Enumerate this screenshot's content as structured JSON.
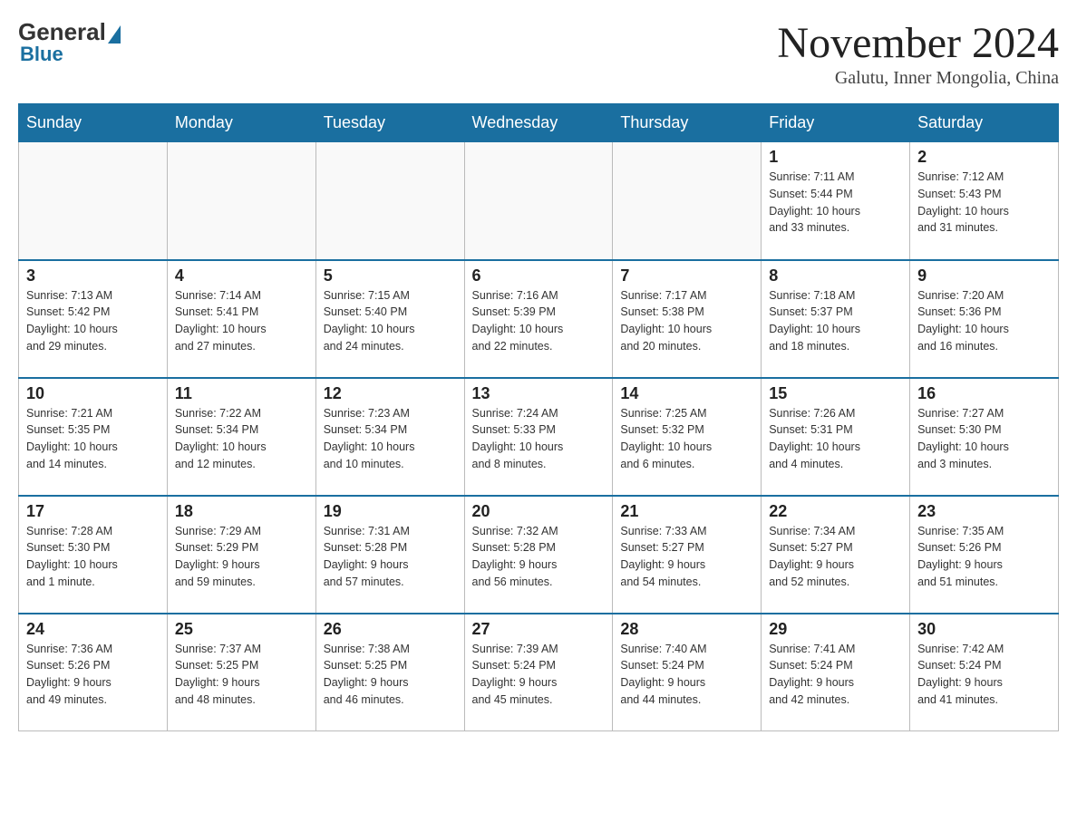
{
  "header": {
    "logo": {
      "general": "General",
      "blue": "Blue"
    },
    "title": "November 2024",
    "location": "Galutu, Inner Mongolia, China"
  },
  "days_of_week": [
    "Sunday",
    "Monday",
    "Tuesday",
    "Wednesday",
    "Thursday",
    "Friday",
    "Saturday"
  ],
  "weeks": [
    [
      {
        "day": "",
        "info": ""
      },
      {
        "day": "",
        "info": ""
      },
      {
        "day": "",
        "info": ""
      },
      {
        "day": "",
        "info": ""
      },
      {
        "day": "",
        "info": ""
      },
      {
        "day": "1",
        "info": "Sunrise: 7:11 AM\nSunset: 5:44 PM\nDaylight: 10 hours\nand 33 minutes."
      },
      {
        "day": "2",
        "info": "Sunrise: 7:12 AM\nSunset: 5:43 PM\nDaylight: 10 hours\nand 31 minutes."
      }
    ],
    [
      {
        "day": "3",
        "info": "Sunrise: 7:13 AM\nSunset: 5:42 PM\nDaylight: 10 hours\nand 29 minutes."
      },
      {
        "day": "4",
        "info": "Sunrise: 7:14 AM\nSunset: 5:41 PM\nDaylight: 10 hours\nand 27 minutes."
      },
      {
        "day": "5",
        "info": "Sunrise: 7:15 AM\nSunset: 5:40 PM\nDaylight: 10 hours\nand 24 minutes."
      },
      {
        "day": "6",
        "info": "Sunrise: 7:16 AM\nSunset: 5:39 PM\nDaylight: 10 hours\nand 22 minutes."
      },
      {
        "day": "7",
        "info": "Sunrise: 7:17 AM\nSunset: 5:38 PM\nDaylight: 10 hours\nand 20 minutes."
      },
      {
        "day": "8",
        "info": "Sunrise: 7:18 AM\nSunset: 5:37 PM\nDaylight: 10 hours\nand 18 minutes."
      },
      {
        "day": "9",
        "info": "Sunrise: 7:20 AM\nSunset: 5:36 PM\nDaylight: 10 hours\nand 16 minutes."
      }
    ],
    [
      {
        "day": "10",
        "info": "Sunrise: 7:21 AM\nSunset: 5:35 PM\nDaylight: 10 hours\nand 14 minutes."
      },
      {
        "day": "11",
        "info": "Sunrise: 7:22 AM\nSunset: 5:34 PM\nDaylight: 10 hours\nand 12 minutes."
      },
      {
        "day": "12",
        "info": "Sunrise: 7:23 AM\nSunset: 5:34 PM\nDaylight: 10 hours\nand 10 minutes."
      },
      {
        "day": "13",
        "info": "Sunrise: 7:24 AM\nSunset: 5:33 PM\nDaylight: 10 hours\nand 8 minutes."
      },
      {
        "day": "14",
        "info": "Sunrise: 7:25 AM\nSunset: 5:32 PM\nDaylight: 10 hours\nand 6 minutes."
      },
      {
        "day": "15",
        "info": "Sunrise: 7:26 AM\nSunset: 5:31 PM\nDaylight: 10 hours\nand 4 minutes."
      },
      {
        "day": "16",
        "info": "Sunrise: 7:27 AM\nSunset: 5:30 PM\nDaylight: 10 hours\nand 3 minutes."
      }
    ],
    [
      {
        "day": "17",
        "info": "Sunrise: 7:28 AM\nSunset: 5:30 PM\nDaylight: 10 hours\nand 1 minute."
      },
      {
        "day": "18",
        "info": "Sunrise: 7:29 AM\nSunset: 5:29 PM\nDaylight: 9 hours\nand 59 minutes."
      },
      {
        "day": "19",
        "info": "Sunrise: 7:31 AM\nSunset: 5:28 PM\nDaylight: 9 hours\nand 57 minutes."
      },
      {
        "day": "20",
        "info": "Sunrise: 7:32 AM\nSunset: 5:28 PM\nDaylight: 9 hours\nand 56 minutes."
      },
      {
        "day": "21",
        "info": "Sunrise: 7:33 AM\nSunset: 5:27 PM\nDaylight: 9 hours\nand 54 minutes."
      },
      {
        "day": "22",
        "info": "Sunrise: 7:34 AM\nSunset: 5:27 PM\nDaylight: 9 hours\nand 52 minutes."
      },
      {
        "day": "23",
        "info": "Sunrise: 7:35 AM\nSunset: 5:26 PM\nDaylight: 9 hours\nand 51 minutes."
      }
    ],
    [
      {
        "day": "24",
        "info": "Sunrise: 7:36 AM\nSunset: 5:26 PM\nDaylight: 9 hours\nand 49 minutes."
      },
      {
        "day": "25",
        "info": "Sunrise: 7:37 AM\nSunset: 5:25 PM\nDaylight: 9 hours\nand 48 minutes."
      },
      {
        "day": "26",
        "info": "Sunrise: 7:38 AM\nSunset: 5:25 PM\nDaylight: 9 hours\nand 46 minutes."
      },
      {
        "day": "27",
        "info": "Sunrise: 7:39 AM\nSunset: 5:24 PM\nDaylight: 9 hours\nand 45 minutes."
      },
      {
        "day": "28",
        "info": "Sunrise: 7:40 AM\nSunset: 5:24 PM\nDaylight: 9 hours\nand 44 minutes."
      },
      {
        "day": "29",
        "info": "Sunrise: 7:41 AM\nSunset: 5:24 PM\nDaylight: 9 hours\nand 42 minutes."
      },
      {
        "day": "30",
        "info": "Sunrise: 7:42 AM\nSunset: 5:24 PM\nDaylight: 9 hours\nand 41 minutes."
      }
    ]
  ]
}
